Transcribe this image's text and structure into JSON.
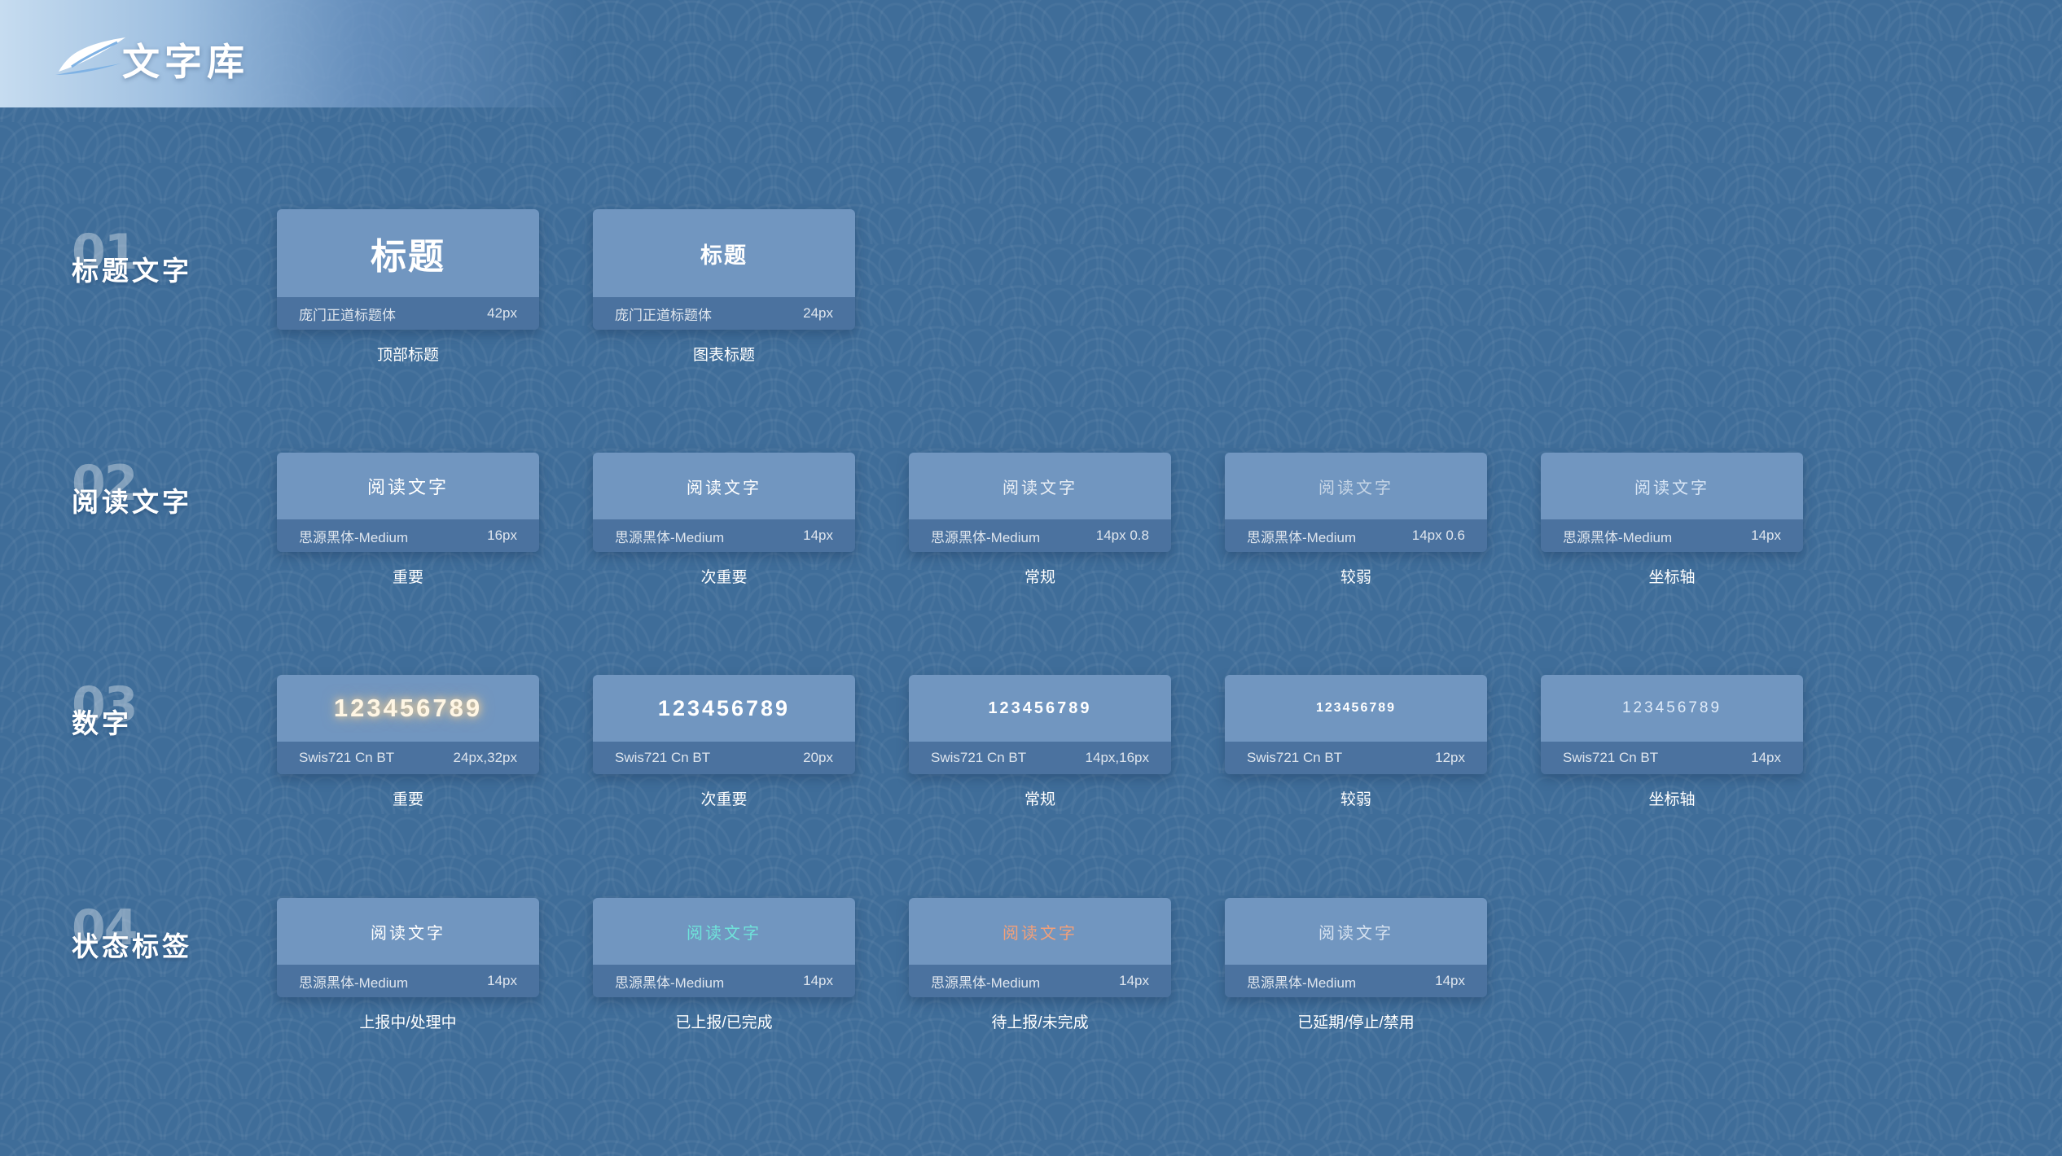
{
  "header": {
    "title": "文字库"
  },
  "colors": {
    "background": "#3f6d99",
    "card_top": "#7196c0",
    "card_bottom": "#4b729f",
    "status_cyan": "#6fe3da",
    "status_orange": "#f2a07a",
    "number_glow": "#ffd89a"
  },
  "sections": [
    {
      "num": "01",
      "title": "标题文字",
      "cards": [
        {
          "sample": "标题",
          "font": "庞门正道标题体",
          "size": "42px",
          "caption": "顶部标题"
        },
        {
          "sample": "标题",
          "font": "庞门正道标题体",
          "size": "24px",
          "caption": "图表标题"
        }
      ]
    },
    {
      "num": "02",
      "title": "阅读文字",
      "cards": [
        {
          "sample": "阅读文字",
          "font": "思源黑体-Medium",
          "size": "16px",
          "caption": "重要"
        },
        {
          "sample": "阅读文字",
          "font": "思源黑体-Medium",
          "size": "14px",
          "caption": "次重要"
        },
        {
          "sample": "阅读文字",
          "font": "思源黑体-Medium",
          "size": "14px  0.8",
          "caption": "常规"
        },
        {
          "sample": "阅读文字",
          "font": "思源黑体-Medium",
          "size": "14px 0.6",
          "caption": "较弱"
        },
        {
          "sample": "阅读文字",
          "font": "思源黑体-Medium",
          "size": "14px",
          "caption": "坐标轴"
        }
      ]
    },
    {
      "num": "03",
      "title": "数字",
      "cards": [
        {
          "sample": "123456789",
          "font": "Swis721 Cn BT",
          "size": "24px,32px",
          "caption": "重要"
        },
        {
          "sample": "123456789",
          "font": "Swis721 Cn BT",
          "size": "20px",
          "caption": "次重要"
        },
        {
          "sample": "123456789",
          "font": "Swis721 Cn BT",
          "size": "14px,16px",
          "caption": "常规"
        },
        {
          "sample": "123456789",
          "font": "Swis721 Cn BT",
          "size": "12px",
          "caption": "较弱"
        },
        {
          "sample": "123456789",
          "font": "Swis721 Cn BT",
          "size": "14px",
          "caption": "坐标轴"
        }
      ]
    },
    {
      "num": "04",
      "title": "状态标签",
      "cards": [
        {
          "sample": "阅读文字",
          "font": "思源黑体-Medium",
          "size": "14px",
          "caption": "上报中/处理中"
        },
        {
          "sample": "阅读文字",
          "font": "思源黑体-Medium",
          "size": "14px",
          "caption": "已上报/已完成"
        },
        {
          "sample": "阅读文字",
          "font": "思源黑体-Medium",
          "size": "14px",
          "caption": "待上报/未完成"
        },
        {
          "sample": "阅读文字",
          "font": "思源黑体-Medium",
          "size": "14px",
          "caption": "已延期/停止/禁用"
        }
      ]
    }
  ]
}
